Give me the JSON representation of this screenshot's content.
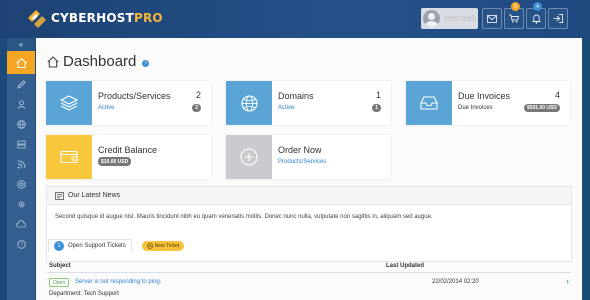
{
  "app": {
    "logo_name": "CYBERHOST",
    "logo_suffix": "PRO",
    "user_name": "Jason Smith",
    "cart_count": "0",
    "notification_count": "4"
  },
  "sidebar": {
    "collapse_label": "«",
    "items": [
      {
        "icon": "home-icon",
        "active": true
      },
      {
        "icon": "pencil-icon"
      },
      {
        "icon": "user-icon"
      },
      {
        "icon": "globe-icon"
      },
      {
        "icon": "server-icon"
      },
      {
        "icon": "rss-icon"
      },
      {
        "icon": "support-icon"
      },
      {
        "icon": "gear-icon"
      },
      {
        "icon": "upload-icon"
      },
      {
        "icon": "question-icon"
      }
    ]
  },
  "page": {
    "title": "Dashboard",
    "info": "i"
  },
  "tiles": {
    "products": {
      "title": "Products/Services",
      "count": "2",
      "link": "Active",
      "badge": "2",
      "color": "#5aa5d6"
    },
    "domains": {
      "title": "Domains",
      "count": "1",
      "link": "Active",
      "badge": "1",
      "color": "#5aa5d6"
    },
    "invoices": {
      "title": "Due Invoices",
      "count": "4",
      "sub": "Due Invoices",
      "badge": "$591.00 USD",
      "color": "#5aa5d6"
    },
    "credit": {
      "title": "Credit Balance",
      "badge": "$10.00 USD",
      "color": "#f8c73c"
    },
    "order": {
      "title": "Order Now",
      "link": "Products/Services",
      "color": "#c9cbce"
    }
  },
  "news": {
    "title": "Our Latest News",
    "body": "Second quisque id augue nisl. Mauris tincidunt nibh eu quam venenatis mollis. Donec nunc nulla, vulputate non sagittis in, aliquam sed augue."
  },
  "tickets": {
    "tab_count": "1",
    "tab_label": "Open Support Tickets",
    "new_label": "New Ticket",
    "columns": {
      "subject": "Subject",
      "updated": "Last Updated"
    },
    "rows": [
      {
        "status": "Open",
        "subject": "Server is not responding to ping.",
        "updated": "22/02/2014 02:20",
        "department": "Department: Tech Support"
      }
    ]
  }
}
